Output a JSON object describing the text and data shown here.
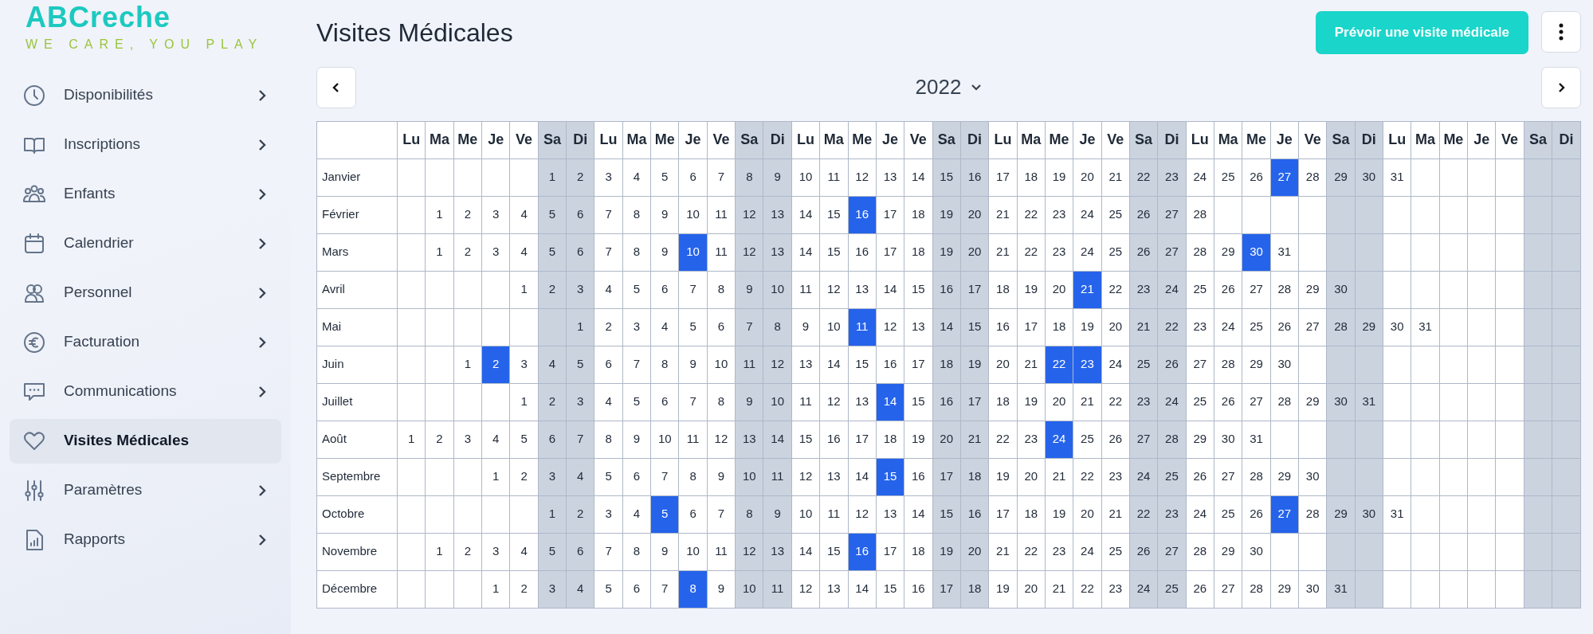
{
  "sidebar": {
    "logo": "ABCreche",
    "tagline": "WE CARE, YOU PLAY",
    "items": [
      {
        "label": "Disponibilités",
        "selected": false,
        "chevron": true
      },
      {
        "label": "Inscriptions",
        "selected": false,
        "chevron": true
      },
      {
        "label": "Enfants",
        "selected": false,
        "chevron": true
      },
      {
        "label": "Calendrier",
        "selected": false,
        "chevron": true
      },
      {
        "label": "Personnel",
        "selected": false,
        "chevron": true
      },
      {
        "label": "Facturation",
        "selected": false,
        "chevron": true
      },
      {
        "label": "Communications",
        "selected": false,
        "chevron": true
      },
      {
        "label": "Visites Médicales",
        "selected": true,
        "chevron": false
      },
      {
        "label": "Paramètres",
        "selected": false,
        "chevron": true
      },
      {
        "label": "Rapports",
        "selected": false,
        "chevron": true
      }
    ]
  },
  "page": {
    "title": "Visites Médicales",
    "primary_button": "Prévoir une visite médicale",
    "year": "2022"
  },
  "calendar": {
    "weekdays": [
      {
        "label": "Lu",
        "weekend": false
      },
      {
        "label": "Ma",
        "weekend": false
      },
      {
        "label": "Me",
        "weekend": false
      },
      {
        "label": "Je",
        "weekend": false
      },
      {
        "label": "Ve",
        "weekend": false
      },
      {
        "label": "Sa",
        "weekend": true
      },
      {
        "label": "Di",
        "weekend": true
      },
      {
        "label": "Lu",
        "weekend": false
      },
      {
        "label": "Ma",
        "weekend": false
      },
      {
        "label": "Me",
        "weekend": false
      },
      {
        "label": "Je",
        "weekend": false
      },
      {
        "label": "Ve",
        "weekend": false
      },
      {
        "label": "Sa",
        "weekend": true
      },
      {
        "label": "Di",
        "weekend": true
      },
      {
        "label": "Lu",
        "weekend": false
      },
      {
        "label": "Ma",
        "weekend": false
      },
      {
        "label": "Me",
        "weekend": false
      },
      {
        "label": "Je",
        "weekend": false
      },
      {
        "label": "Ve",
        "weekend": false
      },
      {
        "label": "Sa",
        "weekend": true
      },
      {
        "label": "Di",
        "weekend": true
      },
      {
        "label": "Lu",
        "weekend": false
      },
      {
        "label": "Ma",
        "weekend": false
      },
      {
        "label": "Me",
        "weekend": false
      },
      {
        "label": "Je",
        "weekend": false
      },
      {
        "label": "Ve",
        "weekend": false
      },
      {
        "label": "Sa",
        "weekend": true
      },
      {
        "label": "Di",
        "weekend": true
      },
      {
        "label": "Lu",
        "weekend": false
      },
      {
        "label": "Ma",
        "weekend": false
      },
      {
        "label": "Me",
        "weekend": false
      },
      {
        "label": "Je",
        "weekend": false
      },
      {
        "label": "Ve",
        "weekend": false
      },
      {
        "label": "Sa",
        "weekend": true
      },
      {
        "label": "Di",
        "weekend": true
      },
      {
        "label": "Lu",
        "weekend": false
      },
      {
        "label": "Ma",
        "weekend": false
      },
      {
        "label": "Me",
        "weekend": false
      },
      {
        "label": "Je",
        "weekend": false
      },
      {
        "label": "Ve",
        "weekend": false
      },
      {
        "label": "Sa",
        "weekend": true
      },
      {
        "label": "Di",
        "weekend": true
      }
    ],
    "months": [
      {
        "name": "Janvier",
        "cells": [
          null,
          null,
          null,
          null,
          null,
          {
            "day": "1",
            "selected": false
          },
          {
            "day": "2",
            "selected": false
          },
          {
            "day": "3",
            "selected": false
          },
          {
            "day": "4",
            "selected": false
          },
          {
            "day": "5",
            "selected": false
          },
          {
            "day": "6",
            "selected": false
          },
          {
            "day": "7",
            "selected": false
          },
          {
            "day": "8",
            "selected": false
          },
          {
            "day": "9",
            "selected": false
          },
          {
            "day": "10",
            "selected": false
          },
          {
            "day": "11",
            "selected": false
          },
          {
            "day": "12",
            "selected": false
          },
          {
            "day": "13",
            "selected": false
          },
          {
            "day": "14",
            "selected": false
          },
          {
            "day": "15",
            "selected": false
          },
          {
            "day": "16",
            "selected": false
          },
          {
            "day": "17",
            "selected": false
          },
          {
            "day": "18",
            "selected": false
          },
          {
            "day": "19",
            "selected": false
          },
          {
            "day": "20",
            "selected": false
          },
          {
            "day": "21",
            "selected": false
          },
          {
            "day": "22",
            "selected": false
          },
          {
            "day": "23",
            "selected": false
          },
          {
            "day": "24",
            "selected": false
          },
          {
            "day": "25",
            "selected": false
          },
          {
            "day": "26",
            "selected": false
          },
          {
            "day": "27",
            "selected": true
          },
          {
            "day": "28",
            "selected": false
          },
          {
            "day": "29",
            "selected": false
          },
          {
            "day": "30",
            "selected": false
          },
          {
            "day": "31",
            "selected": false
          }
        ]
      },
      {
        "name": "Février",
        "cells": [
          null,
          {
            "day": "1",
            "selected": false
          },
          {
            "day": "2",
            "selected": false
          },
          {
            "day": "3",
            "selected": false
          },
          {
            "day": "4",
            "selected": false
          },
          {
            "day": "5",
            "selected": false
          },
          {
            "day": "6",
            "selected": false
          },
          {
            "day": "7",
            "selected": false
          },
          {
            "day": "8",
            "selected": false
          },
          {
            "day": "9",
            "selected": false
          },
          {
            "day": "10",
            "selected": false
          },
          {
            "day": "11",
            "selected": false
          },
          {
            "day": "12",
            "selected": false
          },
          {
            "day": "13",
            "selected": false
          },
          {
            "day": "14",
            "selected": false
          },
          {
            "day": "15",
            "selected": false
          },
          {
            "day": "16",
            "selected": true
          },
          {
            "day": "17",
            "selected": false
          },
          {
            "day": "18",
            "selected": false
          },
          {
            "day": "19",
            "selected": false
          },
          {
            "day": "20",
            "selected": false
          },
          {
            "day": "21",
            "selected": false
          },
          {
            "day": "22",
            "selected": false
          },
          {
            "day": "23",
            "selected": false
          },
          {
            "day": "24",
            "selected": false
          },
          {
            "day": "25",
            "selected": false
          },
          {
            "day": "26",
            "selected": false
          },
          {
            "day": "27",
            "selected": false
          },
          {
            "day": "28",
            "selected": false
          }
        ]
      },
      {
        "name": "Mars",
        "cells": [
          null,
          {
            "day": "1",
            "selected": false
          },
          {
            "day": "2",
            "selected": false
          },
          {
            "day": "3",
            "selected": false
          },
          {
            "day": "4",
            "selected": false
          },
          {
            "day": "5",
            "selected": false
          },
          {
            "day": "6",
            "selected": false
          },
          {
            "day": "7",
            "selected": false
          },
          {
            "day": "8",
            "selected": false
          },
          {
            "day": "9",
            "selected": false
          },
          {
            "day": "10",
            "selected": true
          },
          {
            "day": "11",
            "selected": false
          },
          {
            "day": "12",
            "selected": false
          },
          {
            "day": "13",
            "selected": false
          },
          {
            "day": "14",
            "selected": false
          },
          {
            "day": "15",
            "selected": false
          },
          {
            "day": "16",
            "selected": false
          },
          {
            "day": "17",
            "selected": false
          },
          {
            "day": "18",
            "selected": false
          },
          {
            "day": "19",
            "selected": false
          },
          {
            "day": "20",
            "selected": false
          },
          {
            "day": "21",
            "selected": false
          },
          {
            "day": "22",
            "selected": false
          },
          {
            "day": "23",
            "selected": false
          },
          {
            "day": "24",
            "selected": false
          },
          {
            "day": "25",
            "selected": false
          },
          {
            "day": "26",
            "selected": false
          },
          {
            "day": "27",
            "selected": false
          },
          {
            "day": "28",
            "selected": false
          },
          {
            "day": "29",
            "selected": false
          },
          {
            "day": "30",
            "selected": true
          },
          {
            "day": "31",
            "selected": false
          }
        ]
      },
      {
        "name": "Avril",
        "cells": [
          null,
          null,
          null,
          null,
          {
            "day": "1",
            "selected": false
          },
          {
            "day": "2",
            "selected": false
          },
          {
            "day": "3",
            "selected": false
          },
          {
            "day": "4",
            "selected": false
          },
          {
            "day": "5",
            "selected": false
          },
          {
            "day": "6",
            "selected": false
          },
          {
            "day": "7",
            "selected": false
          },
          {
            "day": "8",
            "selected": false
          },
          {
            "day": "9",
            "selected": false
          },
          {
            "day": "10",
            "selected": false
          },
          {
            "day": "11",
            "selected": false
          },
          {
            "day": "12",
            "selected": false
          },
          {
            "day": "13",
            "selected": false
          },
          {
            "day": "14",
            "selected": false
          },
          {
            "day": "15",
            "selected": false
          },
          {
            "day": "16",
            "selected": false
          },
          {
            "day": "17",
            "selected": false
          },
          {
            "day": "18",
            "selected": false
          },
          {
            "day": "19",
            "selected": false
          },
          {
            "day": "20",
            "selected": false
          },
          {
            "day": "21",
            "selected": true
          },
          {
            "day": "22",
            "selected": false
          },
          {
            "day": "23",
            "selected": false
          },
          {
            "day": "24",
            "selected": false
          },
          {
            "day": "25",
            "selected": false
          },
          {
            "day": "26",
            "selected": false
          },
          {
            "day": "27",
            "selected": false
          },
          {
            "day": "28",
            "selected": false
          },
          {
            "day": "29",
            "selected": false
          },
          {
            "day": "30",
            "selected": false
          }
        ]
      },
      {
        "name": "Mai",
        "cells": [
          null,
          null,
          null,
          null,
          null,
          null,
          {
            "day": "1",
            "selected": false
          },
          {
            "day": "2",
            "selected": false
          },
          {
            "day": "3",
            "selected": false
          },
          {
            "day": "4",
            "selected": false
          },
          {
            "day": "5",
            "selected": false
          },
          {
            "day": "6",
            "selected": false
          },
          {
            "day": "7",
            "selected": false
          },
          {
            "day": "8",
            "selected": false
          },
          {
            "day": "9",
            "selected": false
          },
          {
            "day": "10",
            "selected": false
          },
          {
            "day": "11",
            "selected": true
          },
          {
            "day": "12",
            "selected": false
          },
          {
            "day": "13",
            "selected": false
          },
          {
            "day": "14",
            "selected": false
          },
          {
            "day": "15",
            "selected": false
          },
          {
            "day": "16",
            "selected": false
          },
          {
            "day": "17",
            "selected": false
          },
          {
            "day": "18",
            "selected": false
          },
          {
            "day": "19",
            "selected": false
          },
          {
            "day": "20",
            "selected": false
          },
          {
            "day": "21",
            "selected": false
          },
          {
            "day": "22",
            "selected": false
          },
          {
            "day": "23",
            "selected": false
          },
          {
            "day": "24",
            "selected": false
          },
          {
            "day": "25",
            "selected": false
          },
          {
            "day": "26",
            "selected": false
          },
          {
            "day": "27",
            "selected": false
          },
          {
            "day": "28",
            "selected": false
          },
          {
            "day": "29",
            "selected": false
          },
          {
            "day": "30",
            "selected": false
          },
          {
            "day": "31",
            "selected": false
          }
        ]
      },
      {
        "name": "Juin",
        "cells": [
          null,
          null,
          {
            "day": "1",
            "selected": false
          },
          {
            "day": "2",
            "selected": true
          },
          {
            "day": "3",
            "selected": false
          },
          {
            "day": "4",
            "selected": false
          },
          {
            "day": "5",
            "selected": false
          },
          {
            "day": "6",
            "selected": false
          },
          {
            "day": "7",
            "selected": false
          },
          {
            "day": "8",
            "selected": false
          },
          {
            "day": "9",
            "selected": false
          },
          {
            "day": "10",
            "selected": false
          },
          {
            "day": "11",
            "selected": false
          },
          {
            "day": "12",
            "selected": false
          },
          {
            "day": "13",
            "selected": false
          },
          {
            "day": "14",
            "selected": false
          },
          {
            "day": "15",
            "selected": false
          },
          {
            "day": "16",
            "selected": false
          },
          {
            "day": "17",
            "selected": false
          },
          {
            "day": "18",
            "selected": false
          },
          {
            "day": "19",
            "selected": false
          },
          {
            "day": "20",
            "selected": false
          },
          {
            "day": "21",
            "selected": false
          },
          {
            "day": "22",
            "selected": true
          },
          {
            "day": "23",
            "selected": true
          },
          {
            "day": "24",
            "selected": false
          },
          {
            "day": "25",
            "selected": false
          },
          {
            "day": "26",
            "selected": false
          },
          {
            "day": "27",
            "selected": false
          },
          {
            "day": "28",
            "selected": false
          },
          {
            "day": "29",
            "selected": false
          },
          {
            "day": "30",
            "selected": false
          }
        ]
      },
      {
        "name": "Juillet",
        "cells": [
          null,
          null,
          null,
          null,
          {
            "day": "1",
            "selected": false
          },
          {
            "day": "2",
            "selected": false
          },
          {
            "day": "3",
            "selected": false
          },
          {
            "day": "4",
            "selected": false
          },
          {
            "day": "5",
            "selected": false
          },
          {
            "day": "6",
            "selected": false
          },
          {
            "day": "7",
            "selected": false
          },
          {
            "day": "8",
            "selected": false
          },
          {
            "day": "9",
            "selected": false
          },
          {
            "day": "10",
            "selected": false
          },
          {
            "day": "11",
            "selected": false
          },
          {
            "day": "12",
            "selected": false
          },
          {
            "day": "13",
            "selected": false
          },
          {
            "day": "14",
            "selected": true
          },
          {
            "day": "15",
            "selected": false
          },
          {
            "day": "16",
            "selected": false
          },
          {
            "day": "17",
            "selected": false
          },
          {
            "day": "18",
            "selected": false
          },
          {
            "day": "19",
            "selected": false
          },
          {
            "day": "20",
            "selected": false
          },
          {
            "day": "21",
            "selected": false
          },
          {
            "day": "22",
            "selected": false
          },
          {
            "day": "23",
            "selected": false
          },
          {
            "day": "24",
            "selected": false
          },
          {
            "day": "25",
            "selected": false
          },
          {
            "day": "26",
            "selected": false
          },
          {
            "day": "27",
            "selected": false
          },
          {
            "day": "28",
            "selected": false
          },
          {
            "day": "29",
            "selected": false
          },
          {
            "day": "30",
            "selected": false
          },
          {
            "day": "31",
            "selected": false
          }
        ]
      },
      {
        "name": "Août",
        "cells": [
          {
            "day": "1",
            "selected": false
          },
          {
            "day": "2",
            "selected": false
          },
          {
            "day": "3",
            "selected": false
          },
          {
            "day": "4",
            "selected": false
          },
          {
            "day": "5",
            "selected": false
          },
          {
            "day": "6",
            "selected": false
          },
          {
            "day": "7",
            "selected": false
          },
          {
            "day": "8",
            "selected": false
          },
          {
            "day": "9",
            "selected": false
          },
          {
            "day": "10",
            "selected": false
          },
          {
            "day": "11",
            "selected": false
          },
          {
            "day": "12",
            "selected": false
          },
          {
            "day": "13",
            "selected": false
          },
          {
            "day": "14",
            "selected": false
          },
          {
            "day": "15",
            "selected": false
          },
          {
            "day": "16",
            "selected": false
          },
          {
            "day": "17",
            "selected": false
          },
          {
            "day": "18",
            "selected": false
          },
          {
            "day": "19",
            "selected": false
          },
          {
            "day": "20",
            "selected": false
          },
          {
            "day": "21",
            "selected": false
          },
          {
            "day": "22",
            "selected": false
          },
          {
            "day": "23",
            "selected": false
          },
          {
            "day": "24",
            "selected": true
          },
          {
            "day": "25",
            "selected": false
          },
          {
            "day": "26",
            "selected": false
          },
          {
            "day": "27",
            "selected": false
          },
          {
            "day": "28",
            "selected": false
          },
          {
            "day": "29",
            "selected": false
          },
          {
            "day": "30",
            "selected": false
          },
          {
            "day": "31",
            "selected": false
          }
        ]
      },
      {
        "name": "Septembre",
        "cells": [
          null,
          null,
          null,
          {
            "day": "1",
            "selected": false
          },
          {
            "day": "2",
            "selected": false
          },
          {
            "day": "3",
            "selected": false
          },
          {
            "day": "4",
            "selected": false
          },
          {
            "day": "5",
            "selected": false
          },
          {
            "day": "6",
            "selected": false
          },
          {
            "day": "7",
            "selected": false
          },
          {
            "day": "8",
            "selected": false
          },
          {
            "day": "9",
            "selected": false
          },
          {
            "day": "10",
            "selected": false
          },
          {
            "day": "11",
            "selected": false
          },
          {
            "day": "12",
            "selected": false
          },
          {
            "day": "13",
            "selected": false
          },
          {
            "day": "14",
            "selected": false
          },
          {
            "day": "15",
            "selected": true
          },
          {
            "day": "16",
            "selected": false
          },
          {
            "day": "17",
            "selected": false
          },
          {
            "day": "18",
            "selected": false
          },
          {
            "day": "19",
            "selected": false
          },
          {
            "day": "20",
            "selected": false
          },
          {
            "day": "21",
            "selected": false
          },
          {
            "day": "22",
            "selected": false
          },
          {
            "day": "23",
            "selected": false
          },
          {
            "day": "24",
            "selected": false
          },
          {
            "day": "25",
            "selected": false
          },
          {
            "day": "26",
            "selected": false
          },
          {
            "day": "27",
            "selected": false
          },
          {
            "day": "28",
            "selected": false
          },
          {
            "day": "29",
            "selected": false
          },
          {
            "day": "30",
            "selected": false
          }
        ]
      },
      {
        "name": "Octobre",
        "cells": [
          null,
          null,
          null,
          null,
          null,
          {
            "day": "1",
            "selected": false
          },
          {
            "day": "2",
            "selected": false
          },
          {
            "day": "3",
            "selected": false
          },
          {
            "day": "4",
            "selected": false
          },
          {
            "day": "5",
            "selected": true
          },
          {
            "day": "6",
            "selected": false
          },
          {
            "day": "7",
            "selected": false
          },
          {
            "day": "8",
            "selected": false
          },
          {
            "day": "9",
            "selected": false
          },
          {
            "day": "10",
            "selected": false
          },
          {
            "day": "11",
            "selected": false
          },
          {
            "day": "12",
            "selected": false
          },
          {
            "day": "13",
            "selected": false
          },
          {
            "day": "14",
            "selected": false
          },
          {
            "day": "15",
            "selected": false
          },
          {
            "day": "16",
            "selected": false
          },
          {
            "day": "17",
            "selected": false
          },
          {
            "day": "18",
            "selected": false
          },
          {
            "day": "19",
            "selected": false
          },
          {
            "day": "20",
            "selected": false
          },
          {
            "day": "21",
            "selected": false
          },
          {
            "day": "22",
            "selected": false
          },
          {
            "day": "23",
            "selected": false
          },
          {
            "day": "24",
            "selected": false
          },
          {
            "day": "25",
            "selected": false
          },
          {
            "day": "26",
            "selected": false
          },
          {
            "day": "27",
            "selected": true
          },
          {
            "day": "28",
            "selected": false
          },
          {
            "day": "29",
            "selected": false
          },
          {
            "day": "30",
            "selected": false
          },
          {
            "day": "31",
            "selected": false
          }
        ]
      },
      {
        "name": "Novembre",
        "cells": [
          null,
          {
            "day": "1",
            "selected": false
          },
          {
            "day": "2",
            "selected": false
          },
          {
            "day": "3",
            "selected": false
          },
          {
            "day": "4",
            "selected": false
          },
          {
            "day": "5",
            "selected": false
          },
          {
            "day": "6",
            "selected": false
          },
          {
            "day": "7",
            "selected": false
          },
          {
            "day": "8",
            "selected": false
          },
          {
            "day": "9",
            "selected": false
          },
          {
            "day": "10",
            "selected": false
          },
          {
            "day": "11",
            "selected": false
          },
          {
            "day": "12",
            "selected": false
          },
          {
            "day": "13",
            "selected": false
          },
          {
            "day": "14",
            "selected": false
          },
          {
            "day": "15",
            "selected": false
          },
          {
            "day": "16",
            "selected": true
          },
          {
            "day": "17",
            "selected": false
          },
          {
            "day": "18",
            "selected": false
          },
          {
            "day": "19",
            "selected": false
          },
          {
            "day": "20",
            "selected": false
          },
          {
            "day": "21",
            "selected": false
          },
          {
            "day": "22",
            "selected": false
          },
          {
            "day": "23",
            "selected": false
          },
          {
            "day": "24",
            "selected": false
          },
          {
            "day": "25",
            "selected": false
          },
          {
            "day": "26",
            "selected": false
          },
          {
            "day": "27",
            "selected": false
          },
          {
            "day": "28",
            "selected": false
          },
          {
            "day": "29",
            "selected": false
          },
          {
            "day": "30",
            "selected": false
          }
        ]
      },
      {
        "name": "Décembre",
        "cells": [
          null,
          null,
          null,
          {
            "day": "1",
            "selected": false
          },
          {
            "day": "2",
            "selected": false
          },
          {
            "day": "3",
            "selected": false
          },
          {
            "day": "4",
            "selected": false
          },
          {
            "day": "5",
            "selected": false
          },
          {
            "day": "6",
            "selected": false
          },
          {
            "day": "7",
            "selected": false
          },
          {
            "day": "8",
            "selected": true
          },
          {
            "day": "9",
            "selected": false
          },
          {
            "day": "10",
            "selected": false
          },
          {
            "day": "11",
            "selected": false
          },
          {
            "day": "12",
            "selected": false
          },
          {
            "day": "13",
            "selected": false
          },
          {
            "day": "14",
            "selected": false
          },
          {
            "day": "15",
            "selected": false
          },
          {
            "day": "16",
            "selected": false
          },
          {
            "day": "17",
            "selected": false
          },
          {
            "day": "18",
            "selected": false
          },
          {
            "day": "19",
            "selected": false
          },
          {
            "day": "20",
            "selected": false
          },
          {
            "day": "21",
            "selected": false
          },
          {
            "day": "22",
            "selected": false
          },
          {
            "day": "23",
            "selected": false
          },
          {
            "day": "24",
            "selected": false
          },
          {
            "day": "25",
            "selected": false
          },
          {
            "day": "26",
            "selected": false
          },
          {
            "day": "27",
            "selected": false
          },
          {
            "day": "28",
            "selected": false
          },
          {
            "day": "29",
            "selected": false
          },
          {
            "day": "30",
            "selected": false
          },
          {
            "day": "31",
            "selected": false
          }
        ]
      }
    ]
  }
}
